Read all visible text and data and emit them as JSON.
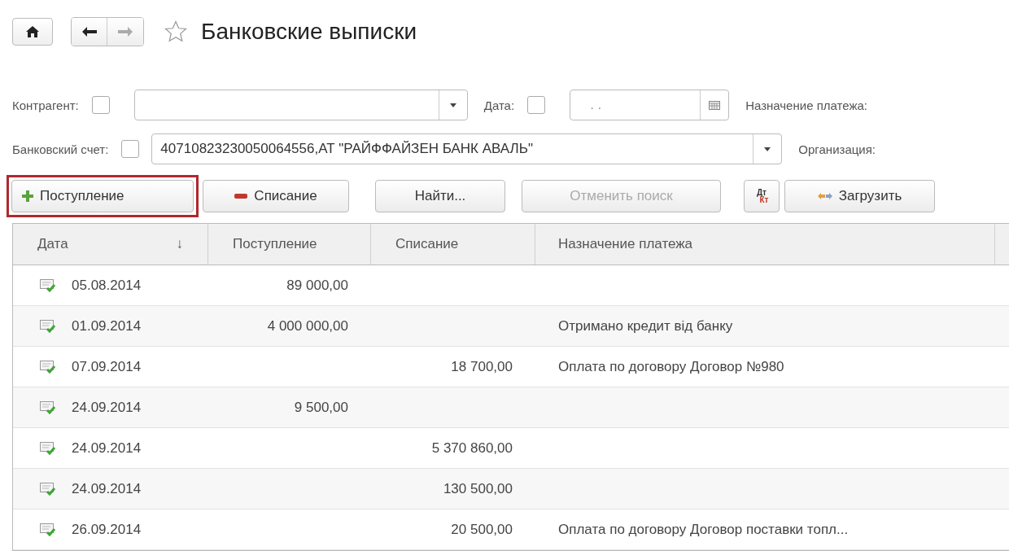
{
  "nav": {
    "back_disabled": false,
    "forward_disabled": true,
    "favorite": false
  },
  "title": "Банковские выписки",
  "filters": [
    {
      "label": "Контрагент:",
      "checked": false,
      "kind": "select"
    },
    {
      "label": "Дата:",
      "checked": false,
      "value": ". .",
      "kind": "date"
    },
    {
      "label": "Назначение платежа:",
      "kind": "label"
    },
    {
      "label": "Банковский счет:",
      "checked": false,
      "value": "40710823230050064556,АТ \"РАЙФФАЙЗЕН БАНК АВАЛЬ\"",
      "kind": "select"
    },
    {
      "label": "Организация:",
      "kind": "label"
    }
  ],
  "toolbar": [
    {
      "kind": "add",
      "label": "Поступление",
      "highlighted": true
    },
    {
      "kind": "remove",
      "label": "Списание"
    },
    {
      "kind": "text",
      "label": "Найти...",
      "disabled": false
    },
    {
      "kind": "text",
      "label": "Отменить поиск",
      "disabled": true
    },
    {
      "kind": "dtkt",
      "top": "Дт",
      "bottom": "Кт"
    },
    {
      "kind": "load",
      "label": "Загрузить"
    }
  ],
  "table": {
    "columns": [
      {
        "label": "Дата",
        "sort_mark": "↓"
      },
      {
        "label": "Поступление"
      },
      {
        "label": "Списание"
      },
      {
        "label": "Назначение платежа"
      }
    ],
    "rows": [
      {
        "date": "05.08.2014",
        "income": "89 000,00",
        "expense": "",
        "purpose": ""
      },
      {
        "date": "01.09.2014",
        "income": "4 000 000,00",
        "expense": "",
        "purpose": "Отримано кредит від банку"
      },
      {
        "date": "07.09.2014",
        "income": "",
        "expense": "18 700,00",
        "purpose": "Оплата по договору Договор №980"
      },
      {
        "date": "24.09.2014",
        "income": "9 500,00",
        "expense": "",
        "purpose": ""
      },
      {
        "date": "24.09.2014",
        "income": "",
        "expense": "5 370 860,00",
        "purpose": ""
      },
      {
        "date": "24.09.2014",
        "income": "",
        "expense": "130 500,00",
        "purpose": ""
      },
      {
        "date": "26.09.2014",
        "income": "",
        "expense": "20 500,00",
        "purpose": "Оплата по договору Договор поставки топл..."
      }
    ]
  }
}
